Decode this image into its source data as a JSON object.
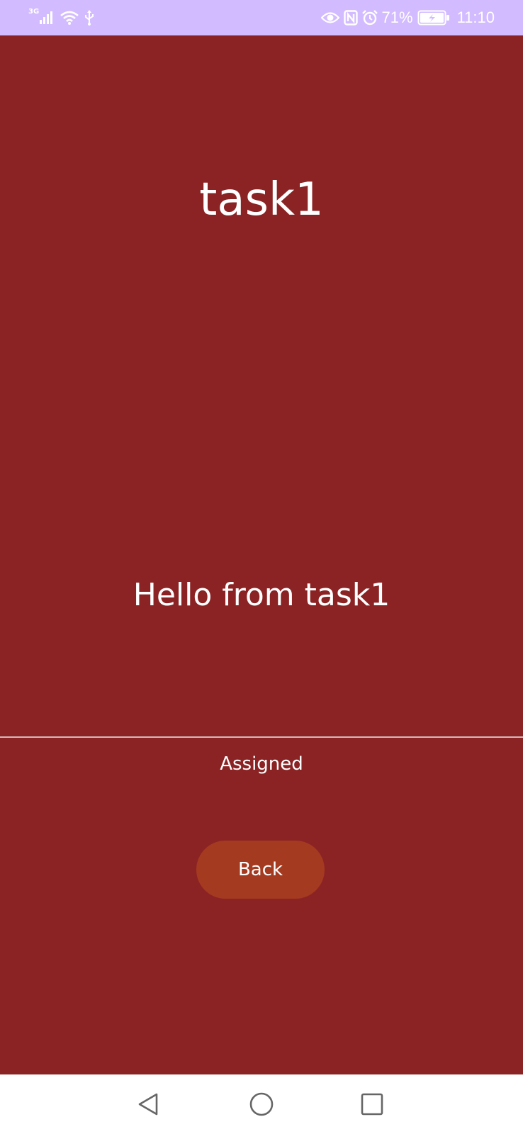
{
  "status_bar": {
    "network_type": "3G",
    "battery_percent": "71%",
    "time": "11:10",
    "icons": [
      "signal-icon",
      "wifi-icon",
      "usb-icon",
      "eye-icon",
      "nfc-icon",
      "alarm-icon",
      "battery-charging-icon"
    ],
    "background": "#d2bbff"
  },
  "screen": {
    "title": "task1",
    "message": "Hello from task1",
    "status": "Assigned",
    "back_label": "Back",
    "background": "#8b2324",
    "button_color": "#a43a20"
  },
  "nav_bar": {
    "icons": [
      "nav-back-icon",
      "nav-home-icon",
      "nav-recents-icon"
    ]
  }
}
